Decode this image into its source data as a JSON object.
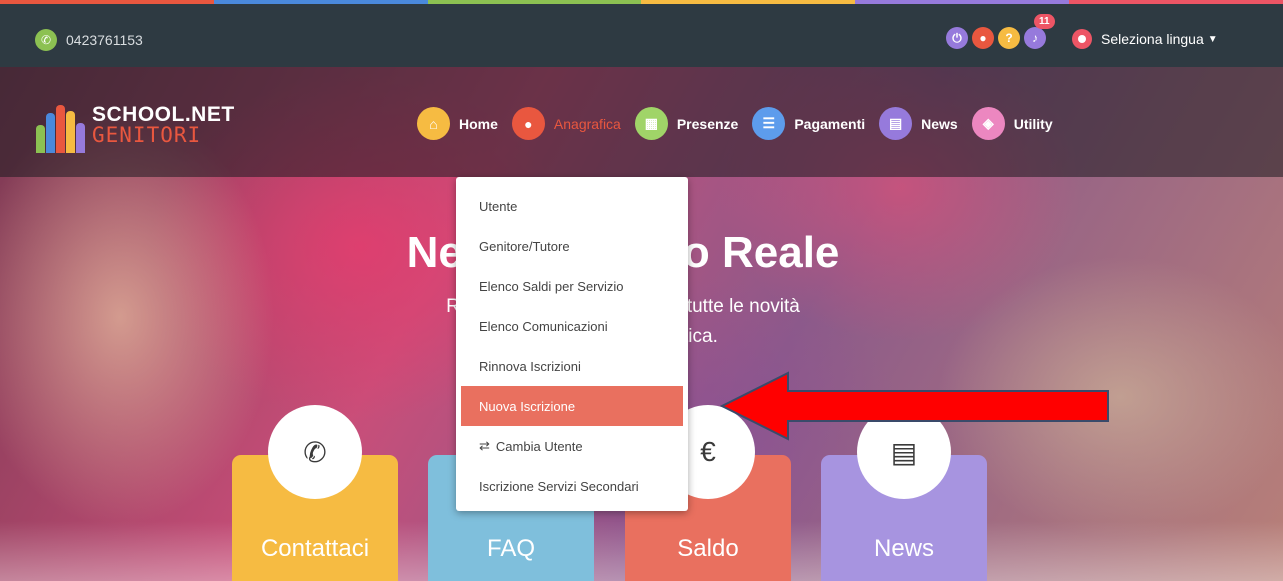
{
  "colors": {
    "topbar": "#2e3a42",
    "rainbow": [
      "#e9573f",
      "#4a89dc",
      "#8cc152",
      "#f6bb42",
      "#967adc",
      "#ed5565"
    ],
    "accent_red": "#e9573f",
    "highlight": "#e9705f",
    "arrow": "#ff0000"
  },
  "topbar": {
    "phone": "0423761153",
    "icons": [
      {
        "name": "power-icon",
        "color": "#967adc",
        "glyph": "⏻"
      },
      {
        "name": "user-icon",
        "color": "#e9573f",
        "glyph": "●"
      },
      {
        "name": "help-icon",
        "color": "#f6bb42",
        "glyph": "?"
      },
      {
        "name": "bell-icon",
        "color": "#967adc",
        "glyph": "♪"
      }
    ],
    "notification_count": "11",
    "language_label": "Seleziona lingua"
  },
  "logo": {
    "line1": "SCHOOL.NET",
    "line2": "GENITORI"
  },
  "nav": {
    "items": [
      {
        "label": "Home",
        "color": "#f6bb42",
        "icon": "home-icon",
        "glyph": "⌂"
      },
      {
        "label": "Anagrafica",
        "color": "#e9573f",
        "icon": "user-icon",
        "glyph": "●"
      },
      {
        "label": "Presenze",
        "color": "#a0d468",
        "icon": "calendar-icon",
        "glyph": "▦"
      },
      {
        "label": "Pagamenti",
        "color": "#5d9cec",
        "icon": "list-icon",
        "glyph": "☰"
      },
      {
        "label": "News",
        "color": "#967adc",
        "icon": "newspaper-icon",
        "glyph": "▤"
      },
      {
        "label": "Utility",
        "color": "#ec87c0",
        "icon": "link-icon",
        "glyph": "◈"
      }
    ]
  },
  "hero": {
    "title": "Nev                o Reale",
    "subtitle_line1": "Rimar                                    tutte le novità",
    "subtitle_line2": "olastica."
  },
  "dropdown": {
    "items": [
      "Utente",
      "Genitore/Tutore",
      "Elenco Saldi per Servizio",
      "Elenco Comunicazioni",
      "Rinnova Iscrizioni",
      "Nuova Iscrizione",
      "Cambia Utente",
      "Iscrizione Servizi Secondari"
    ],
    "highlighted_index": 5
  },
  "cards": [
    {
      "label": "Contattaci",
      "color": "#f6bb42",
      "icon": "phone-icon",
      "glyph": "✆"
    },
    {
      "label": "FAQ",
      "color": "#7fbfdc",
      "icon": "question-icon",
      "glyph": "?"
    },
    {
      "label": "Saldo",
      "color": "#e9705f",
      "icon": "euro-icon",
      "glyph": "€"
    },
    {
      "label": "News",
      "color": "#a794e0",
      "icon": "newspaper-icon",
      "glyph": "▤"
    }
  ]
}
